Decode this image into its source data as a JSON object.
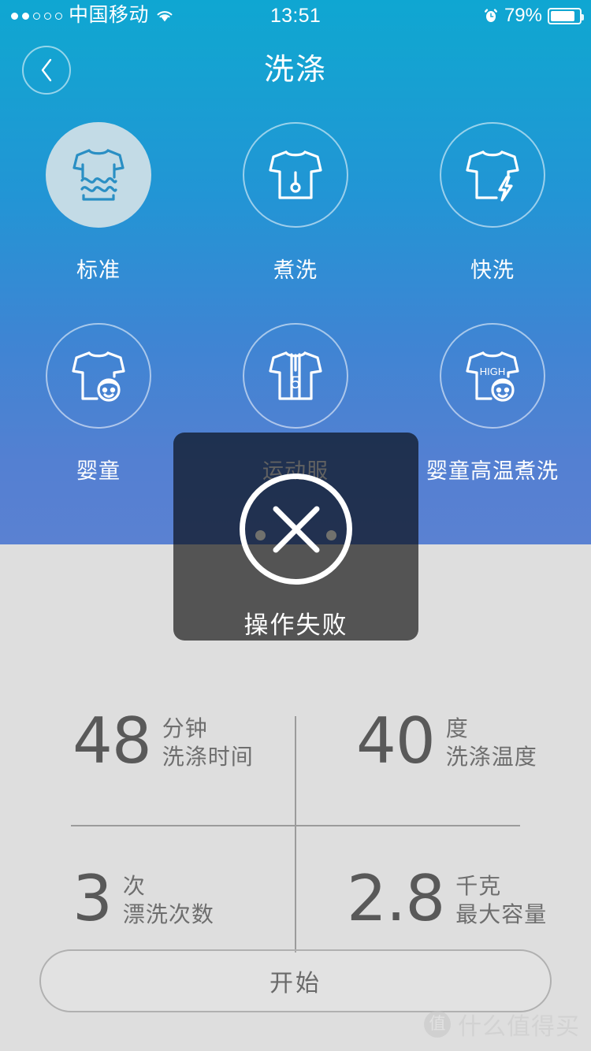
{
  "status_bar": {
    "signal_dots_filled": 2,
    "signal_dots_total": 5,
    "carrier": "中国移动",
    "wifi_icon": "wifi-icon",
    "time": "13:51",
    "alarm_icon": "alarm-clock-icon",
    "battery_percent": "79%",
    "battery_level": 79
  },
  "navbar": {
    "back_icon": "chevron-left-icon",
    "title": "洗涤"
  },
  "modes": [
    {
      "label": "标准",
      "icon": "shirt-waves-icon",
      "selected": true
    },
    {
      "label": "煮洗",
      "icon": "shirt-thermometer-icon",
      "selected": false
    },
    {
      "label": "快洗",
      "icon": "shirt-bolt-icon",
      "selected": false
    },
    {
      "label": "婴童",
      "icon": "shirt-baby-icon",
      "selected": false
    },
    {
      "label": "运动服",
      "icon": "shirt-number5-icon",
      "selected": false
    },
    {
      "label": "婴童高温煮洗",
      "icon": "shirt-high-baby-icon",
      "selected": false
    }
  ],
  "specs": [
    {
      "value": "48",
      "unit": "分钟",
      "name": "洗涤时间"
    },
    {
      "value": "40",
      "unit": "度",
      "name": "洗涤温度"
    },
    {
      "value": "3",
      "unit": "次",
      "name": "漂洗次数"
    },
    {
      "value": "2.8",
      "unit": "千克",
      "name": "最大容量"
    }
  ],
  "start_button": {
    "label": "开始"
  },
  "toast": {
    "icon": "x-circle-icon",
    "message": "操作失败"
  },
  "watermark": {
    "logo_text": "值",
    "text": "什么值得买"
  },
  "colors": {
    "gradient_top": "#0FA6D2",
    "gradient_bottom": "#5A81D2",
    "panel_bg": "#DEDEDE",
    "selected_circle": "#C3DBE6",
    "spec_text": "#6E6E6E",
    "divider": "#9B9B9B"
  }
}
